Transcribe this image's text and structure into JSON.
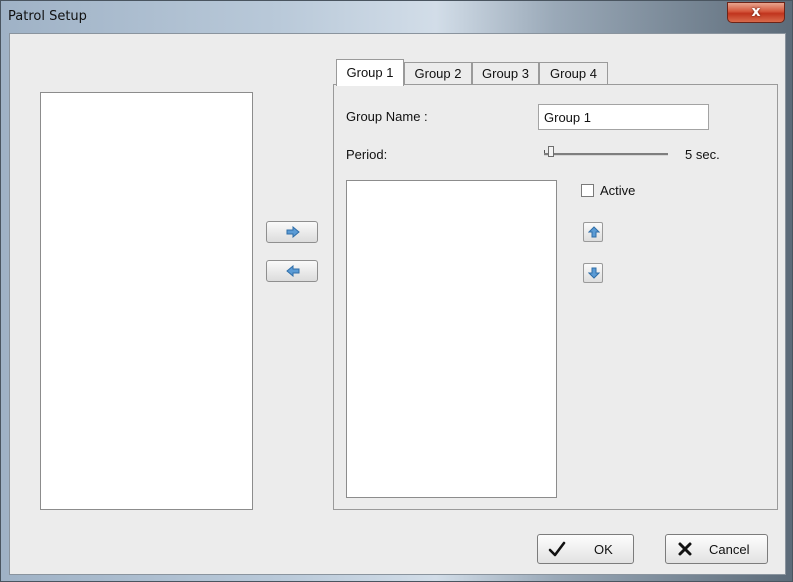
{
  "window": {
    "title": "Patrol Setup",
    "close_glyph": "x"
  },
  "transfer": {
    "add_icon": "arrow-right-icon",
    "remove_icon": "arrow-left-icon"
  },
  "tabs": [
    {
      "label": "Group 1",
      "active": true
    },
    {
      "label": "Group 2",
      "active": false
    },
    {
      "label": "Group 3",
      "active": false
    },
    {
      "label": "Group 4",
      "active": false
    }
  ],
  "group": {
    "name_label": "Group Name :",
    "name_value": "Group 1",
    "period_label": "Period:",
    "period_value": 5,
    "period_text": "5 sec.",
    "active_label": "Active",
    "active_checked": false,
    "move_up_icon": "arrow-up-icon",
    "move_down_icon": "arrow-down-icon"
  },
  "footer": {
    "ok_label": "OK",
    "cancel_label": "Cancel"
  },
  "colors": {
    "arrow_blue": "#5b9bd5",
    "close_red": "#c7432a"
  }
}
